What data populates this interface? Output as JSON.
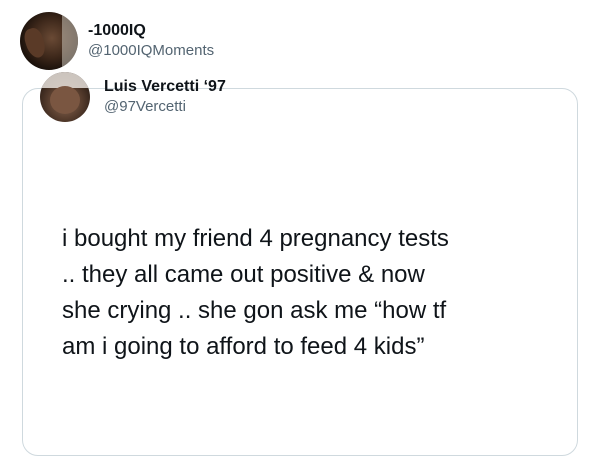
{
  "outer_tweet": {
    "display_name": "-1000IQ",
    "handle": "@1000IQMoments"
  },
  "quoted_tweet": {
    "display_name": "Luis Vercetti ‘97",
    "handle": "@97Vercetti",
    "text": "i bought my friend 4 pregnancy tests\n.. they all came out positive & now\nshe crying .. she gon ask me “how tf\nam i going to afford to feed 4 kids”"
  }
}
